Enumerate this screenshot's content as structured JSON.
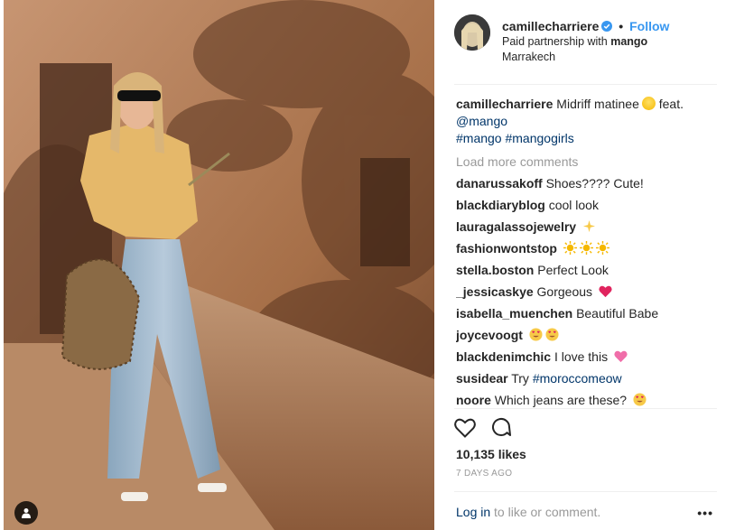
{
  "post": {
    "author": "camillecharriere",
    "follow_label": "Follow",
    "separator": "•",
    "partnership_prefix": "Paid partnership with",
    "partner": "mango",
    "location": "Marrakech"
  },
  "caption": {
    "user": "camillecharriere",
    "text": "Midriff matinee",
    "feat": "feat.",
    "mention": "@mango",
    "hashtags": "#mango #mangogirls"
  },
  "load_more_label": "Load more comments",
  "comments": [
    {
      "user": "danarussakoff",
      "text": "Shoes???? Cute!"
    },
    {
      "user": "blackdiaryblog",
      "text": "cool look"
    },
    {
      "user": "lauragalassojewelry",
      "text": ""
    },
    {
      "user": "fashionwontstop",
      "text": ""
    },
    {
      "user": "stella.boston",
      "text": "Perfect Look"
    },
    {
      "user": "_jessicaskye",
      "text": "Gorgeous"
    },
    {
      "user": "isabella_muenchen",
      "text": "Beautiful Babe"
    },
    {
      "user": "joycevoogt",
      "text": ""
    },
    {
      "user": "blackdenimchic",
      "text": "I love this"
    },
    {
      "user": "susidear",
      "text": "Try",
      "link": "#moroccomeow"
    },
    {
      "user": "noore",
      "text": "Which jeans are these?"
    }
  ],
  "likes": "10,135 likes",
  "time": "7 DAYS AGO",
  "login": {
    "link": "Log in",
    "text": "to like or comment."
  },
  "more_label": "•••",
  "colors": {
    "accent": "#3897f0",
    "link": "#003569",
    "muted": "#999999"
  }
}
